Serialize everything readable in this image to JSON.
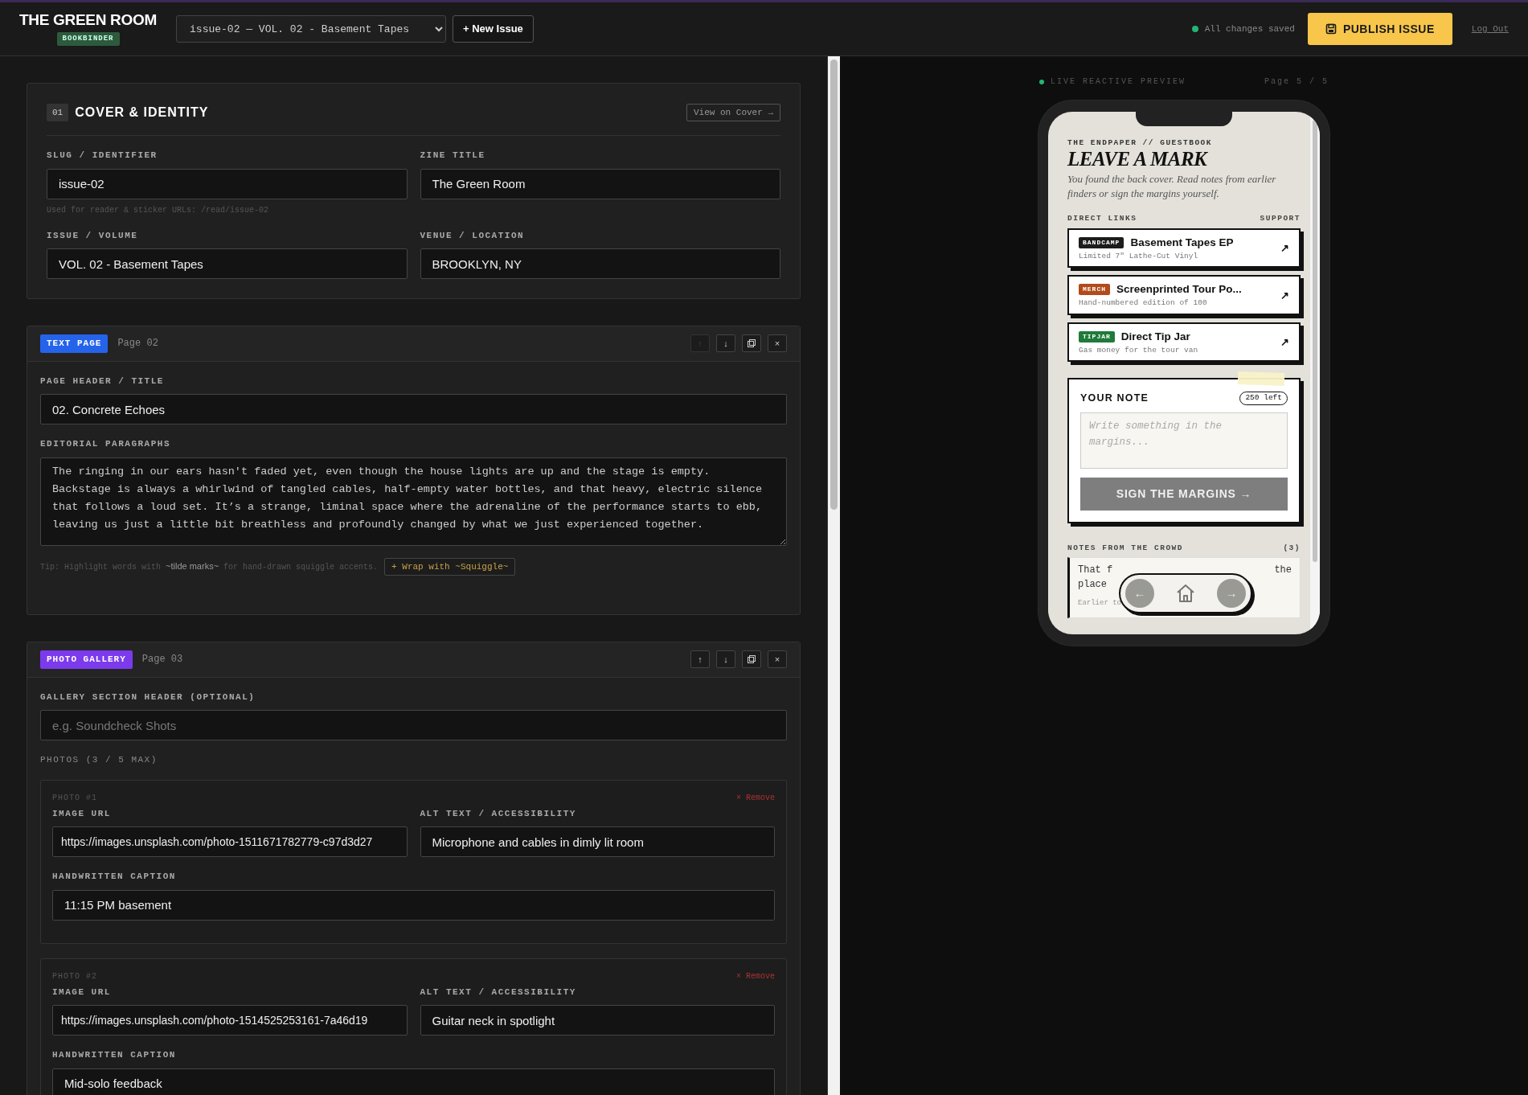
{
  "header": {
    "brand": "THE GREEN ROOM",
    "brand_tag": "BOOKBINDER",
    "issue_select": "issue-02 — VOL. 02 - Basement Tapes",
    "new_button": "+ New Issue",
    "save_status": "All changes saved",
    "publish_button": "PUBLISH ISSUE",
    "logout": "Log Out"
  },
  "cover": {
    "number": "01",
    "title": "COVER & IDENTITY",
    "view_button": "View on Cover →",
    "fields": [
      {
        "label": "SLUG / IDENTIFIER",
        "value": "issue-02",
        "help": "Used for reader & sticker URLs: /read/issue-02"
      },
      {
        "label": "ZINE TITLE",
        "value": "The Green Room"
      },
      {
        "label": "ISSUE / VOLUME",
        "value": "VOL. 02 - Basement Tapes"
      },
      {
        "label": "VENUE / LOCATION",
        "value": "BROOKLYN, NY"
      }
    ]
  },
  "pages": [
    {
      "kind": "text",
      "type_label": "TEXT PAGE",
      "page": "Page 02",
      "controls": [
        {
          "kind": "up",
          "symbol": "↑",
          "disabled": true
        },
        {
          "kind": "down",
          "symbol": "↓",
          "disabled": false
        },
        {
          "kind": "copy",
          "disabled": false
        },
        {
          "kind": "close",
          "symbol": "×",
          "disabled": false
        }
      ],
      "title_label": "PAGE HEADER / TITLE",
      "title_value": "02. Concrete Echoes",
      "body_label": "EDITORIAL PARAGRAPHS",
      "body_value": "The ringing in our ears hasn't faded yet, even though the house lights are up and the stage is empty. Backstage is always a whirlwind of tangled cables, half-empty water bottles, and that heavy, electric silence that follows a loud set. It’s a strange, liminal space where the adrenaline of the performance starts to ebb, leaving us just a little bit breathless and profoundly changed by what we just experienced together.",
      "tip": "Tip: Highlight words with **~tilde marks~** for hand-drawn squiggle accents.",
      "wrap_button": "+ Wrap with ~Squiggle~"
    },
    {
      "kind": "gallery",
      "type_label": "PHOTO GALLERY",
      "page": "Page 03",
      "controls": [
        {
          "kind": "up",
          "symbol": "↑",
          "disabled": false
        },
        {
          "kind": "down",
          "symbol": "↓",
          "disabled": false
        },
        {
          "kind": "copy",
          "disabled": false
        },
        {
          "kind": "close",
          "symbol": "×",
          "disabled": false
        }
      ],
      "header_label": "GALLERY SECTION HEADER (OPTIONAL)",
      "header_placeholder": "e.g. Soundcheck Shots",
      "photos_label": "PHOTOS (3 / 5 MAX)",
      "photos": [
        {
          "number": "PHOTO #1",
          "remove": "× Remove",
          "url_label": "IMAGE URL",
          "url": "https://images.unsplash.com/photo-1511671782779-c97d3d27",
          "alt_label": "ALT TEXT / ACCESSIBILITY",
          "alt": "Microphone and cables in dimly lit room",
          "caption_label": "HANDWRITTEN CAPTION",
          "caption": "11:15 PM basement"
        },
        {
          "number": "PHOTO #2",
          "remove": "× Remove",
          "url_label": "IMAGE URL",
          "url": "https://images.unsplash.com/photo-1514525253161-7a46d19",
          "alt_label": "ALT TEXT / ACCESSIBILITY",
          "alt": "Guitar neck in spotlight",
          "caption_label": "HANDWRITTEN CAPTION",
          "caption": "Mid-solo feedback"
        }
      ]
    }
  ],
  "preview": {
    "status": "LIVE REACTIVE PREVIEW",
    "page": "Page 5 / 5",
    "kicker": "THE ENDPAPER // GUESTBOOK",
    "title": "LEAVE A MARK",
    "intro": "You found the back cover. Read notes from earlier finders or sign the margins yourself.",
    "links_label": "DIRECT LINKS",
    "support_label": "SUPPORT",
    "links": [
      {
        "tag": "BANDCAMP",
        "color": "#1c1c1c",
        "title": "Basement Tapes EP",
        "sub": "Limited 7\" Lathe-Cut Vinyl",
        "arrow": "↗"
      },
      {
        "tag": "MERCH",
        "color": "#b24a1b",
        "title": "Screenprinted Tour Po...",
        "sub": "Hand-numbered edition of 100",
        "arrow": "↗"
      },
      {
        "tag": "TIPJAR",
        "color": "#1f7a3b",
        "title": "Direct Tip Jar",
        "sub": "Gas money for the tour van",
        "arrow": "↗"
      }
    ],
    "note": {
      "title": "YOUR NOTE",
      "counter": "250 left",
      "placeholder": "Write something in the margins...",
      "button": "SIGN THE MARGINS →",
      "disabled": true
    },
    "crowd": {
      "title": "NOTES FROM THE CROWD",
      "count": "(3)",
      "left": "That f",
      "right": "the",
      "line2": "place",
      "meta": "Earlier to"
    },
    "nav": {
      "prev": "←",
      "next": "→"
    }
  }
}
